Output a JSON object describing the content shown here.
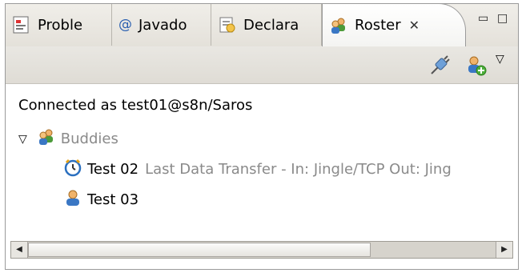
{
  "tabs": [
    {
      "label": "Proble",
      "icon": "problems-icon"
    },
    {
      "label": "Javado",
      "icon": "javadoc-icon",
      "prefix": "@"
    },
    {
      "label": "Declara",
      "icon": "declaration-icon"
    },
    {
      "label": "Roster",
      "icon": "roster-icon",
      "close": "✕"
    }
  ],
  "window_controls": {
    "minimize": "▭",
    "maximize": "□"
  },
  "toolbar": {
    "connect_icon": "plug-connect-icon",
    "add_contact_icon": "add-buddy-icon",
    "view_menu": "▽"
  },
  "content": {
    "connected_text": "Connected as test01@s8n/Saros",
    "group": {
      "label": "Buddies",
      "expander": "▽"
    },
    "buddies": [
      {
        "name": "Test 02",
        "status": "Last Data Transfer - In: Jingle/TCP Out: Jing",
        "icon": "transfer-clock-icon"
      },
      {
        "name": "Test 03",
        "status": "",
        "icon": "buddy-icon"
      }
    ]
  },
  "scrollbar": {
    "left_arrow": "◀",
    "right_arrow": "▶"
  }
}
